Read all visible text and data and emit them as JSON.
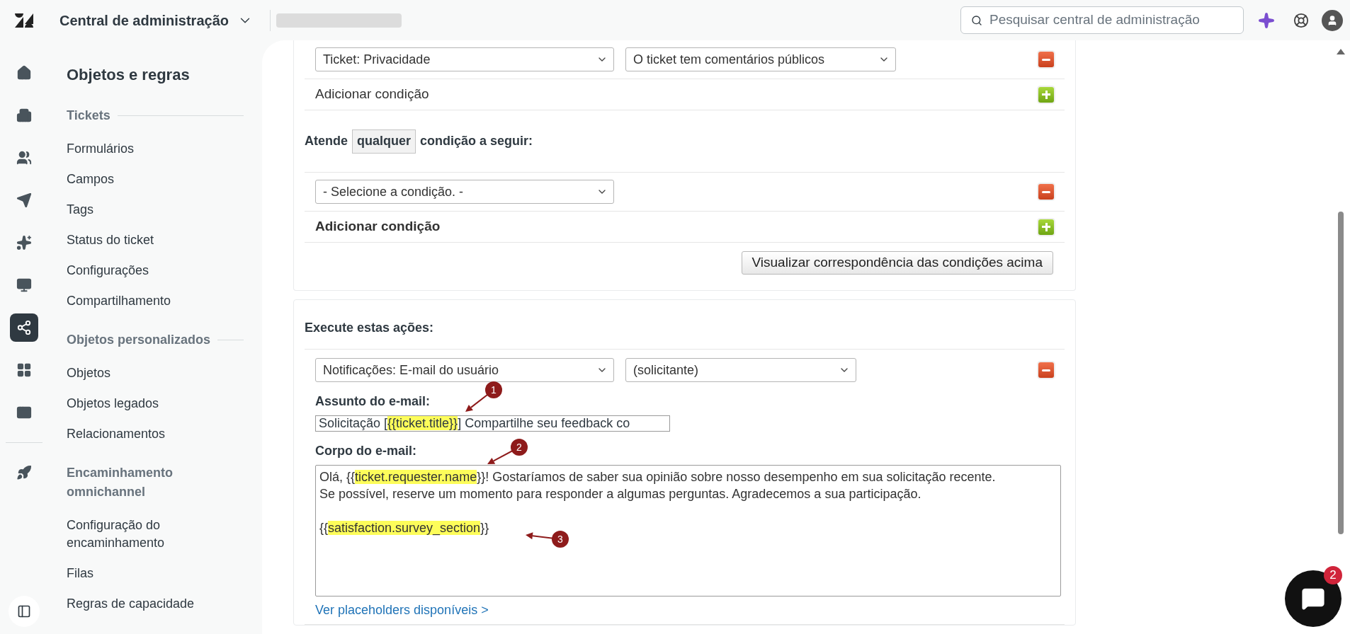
{
  "header": {
    "title": "Central de administração",
    "search": {
      "placeholder": "Pesquisar central de administração"
    }
  },
  "rail_items": [
    {
      "selected": false
    },
    {
      "selected": false
    },
    {
      "selected": false
    },
    {
      "selected": false
    },
    {
      "selected": false
    },
    {
      "selected": false
    },
    {
      "selected": true
    },
    {
      "selected": false
    },
    {
      "selected": false
    },
    {
      "selected": false
    }
  ],
  "sidebar": {
    "title": "Objetos e regras",
    "sections": [
      {
        "heading": "Tickets",
        "items": [
          "Formulários",
          "Campos",
          "Tags",
          "Status do ticket",
          "Configurações",
          "Compartilhamento"
        ]
      },
      {
        "heading": "Objetos personalizados",
        "items": [
          "Objetos",
          "Objetos legados",
          "Relacionamentos"
        ]
      },
      {
        "heading": "Encaminhamento omnichannel",
        "items": [
          "Configuração do encaminhamento",
          "Filas",
          "Regras de capacidade"
        ]
      }
    ]
  },
  "conditions_card": {
    "all_rows": [
      {
        "kind": "condition",
        "field": "Ticket: Privacidade",
        "value": "O ticket tem comentários públicos"
      },
      {
        "kind": "add",
        "label": "Adicionar condição",
        "bold": false
      }
    ],
    "any": {
      "prefix": "Atende",
      "value": "qualquer",
      "suffix": "condição a seguir:"
    },
    "any_rows": [
      {
        "kind": "condition",
        "field": "- Selecione a condição. -"
      },
      {
        "kind": "add",
        "label": "Adicionar condição",
        "bold": true
      }
    ],
    "preview_button": "Visualizar correspondência das condições acima"
  },
  "actions_card": {
    "title": "Execute estas ações:",
    "action": {
      "field": "Notificações: E-mail do usuário",
      "value": "(solicitante)"
    },
    "subject_label": "Assunto do e-mail:",
    "subject": [
      {
        "text": "Solicitação [",
        "highlighted": false
      },
      {
        "text": "{{ticket.title}}",
        "highlighted": true
      },
      {
        "text": "] Compartilhe seu feedback co",
        "highlighted": false
      }
    ],
    "body_label": "Corpo do e-mail:",
    "body": [
      [
        {
          "text": "Olá, {{",
          "highlighted": false
        },
        {
          "text": "ticket.requester.name",
          "highlighted": true
        },
        {
          "text": "}}! Gostaríamos de saber sua opinião sobre nosso desempenho em sua solicitação recente. Se possível, reserve um momento para responder a algumas perguntas. Agradecemos a sua participação.",
          "highlighted": false
        }
      ],
      [
        {
          "text": "{{",
          "highlighted": false
        },
        {
          "text": "satisfaction.survey_section",
          "highlighted": true
        },
        {
          "text": "}}",
          "highlighted": false
        }
      ]
    ],
    "placeholders_link": "Ver placeholders disponíveis >"
  },
  "annotations": [
    "1",
    "2",
    "3"
  ],
  "chat": {
    "badge": "2"
  }
}
